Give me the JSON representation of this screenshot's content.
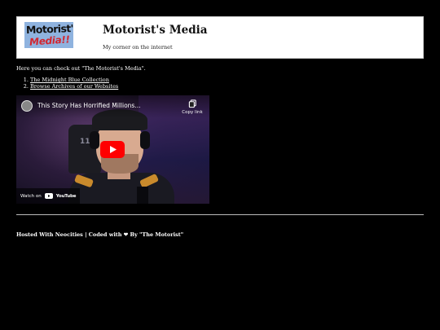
{
  "header": {
    "logo_text_top": "Motorist's",
    "logo_text_bottom": "Media!!",
    "title": "Motorist's Media",
    "tagline": "My corner on the internet"
  },
  "main": {
    "intro": "Here you can check out \"The Motorist's Media\".",
    "links": [
      {
        "label": "The Midnight Blue Collection"
      },
      {
        "label": "Browse Archives of our Websites"
      }
    ]
  },
  "video": {
    "title": "This Story Has Horrified Millions...",
    "copy_label": "Copy link",
    "watch_on_label": "Watch on",
    "youtube_label": "YouTube",
    "chair_number": "117",
    "icons": {
      "play": "play-icon",
      "copy": "copy-icon",
      "youtube": "youtube-icon"
    },
    "colors": {
      "play_button": "#ff0000"
    }
  },
  "footer": {
    "text": "Hosted With Neocities | Coded with ❤ By \"The Motorist\""
  }
}
